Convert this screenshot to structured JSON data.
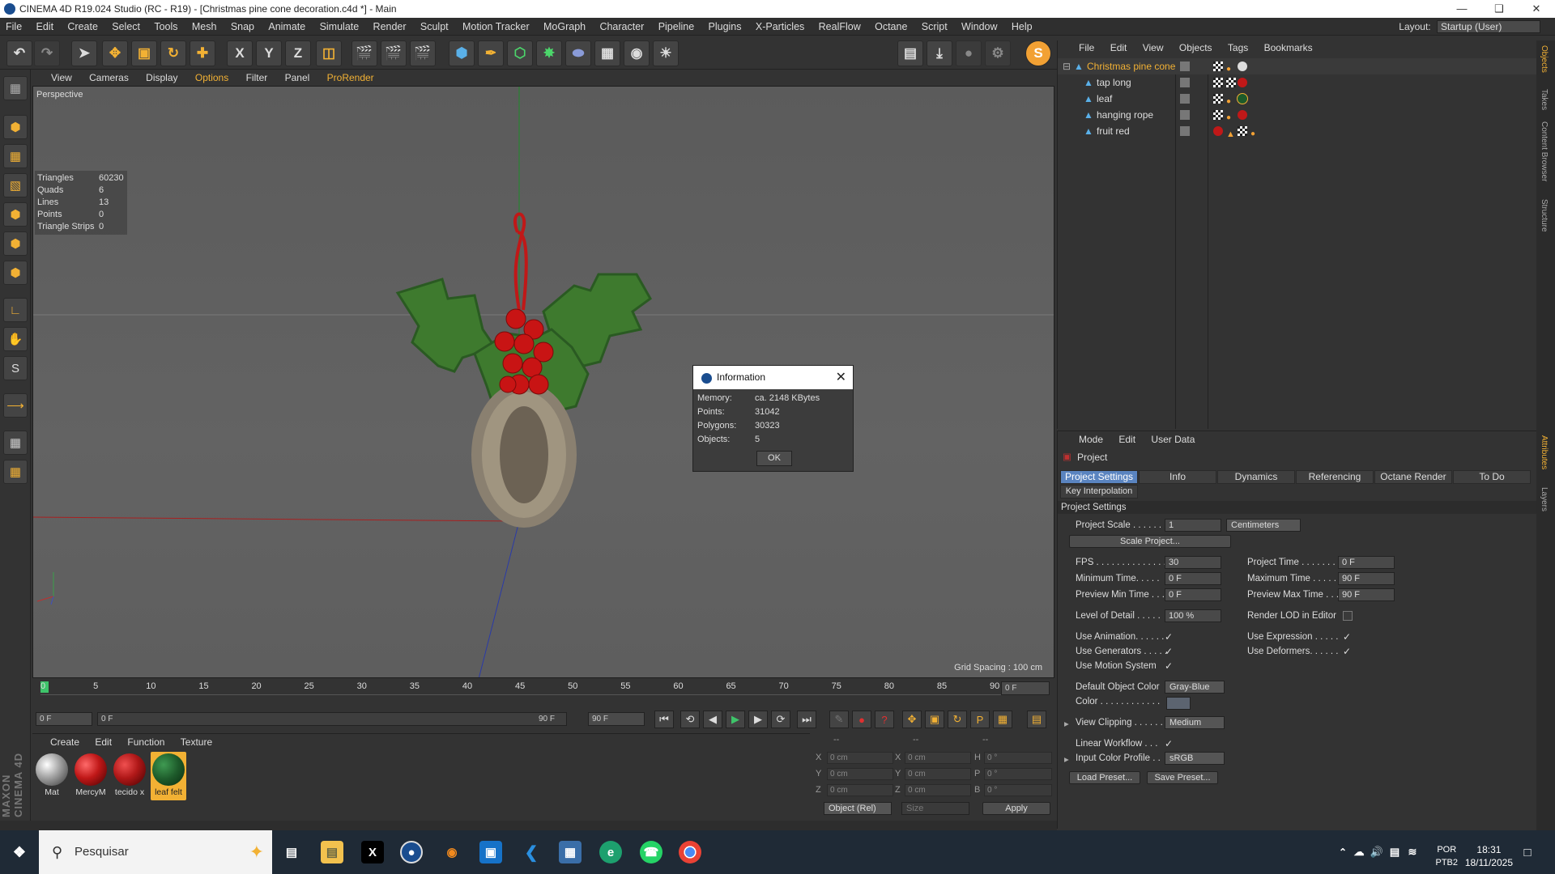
{
  "window": {
    "title": "CINEMA 4D R19.024 Studio (RC - R19) - [Christmas pine cone decoration.c4d *] - Main"
  },
  "menubar": {
    "items": [
      "File",
      "Edit",
      "Create",
      "Select",
      "Tools",
      "Mesh",
      "Snap",
      "Animate",
      "Simulate",
      "Render",
      "Sculpt",
      "Motion Tracker",
      "MoGraph",
      "Character",
      "Pipeline",
      "Plugins",
      "X-Particles",
      "RealFlow",
      "Octane",
      "Script",
      "Window",
      "Help"
    ],
    "layout_label": "Layout:",
    "layout_value": "Startup (User)"
  },
  "viewport": {
    "menu": [
      "View",
      "Cameras",
      "Display",
      "Options",
      "Filter",
      "Panel",
      "ProRender"
    ],
    "label": "Perspective",
    "stats": [
      {
        "k": "Triangles",
        "v": "60230"
      },
      {
        "k": "Quads",
        "v": "6"
      },
      {
        "k": "Lines",
        "v": "13"
      },
      {
        "k": "Points",
        "v": "0"
      },
      {
        "k": "Triangle Strips",
        "v": "0"
      }
    ],
    "grid_spacing": "Grid Spacing : 100 cm"
  },
  "dialog": {
    "title": "Information",
    "rows": [
      {
        "k": "Memory:",
        "v": "ca. 2148 KBytes"
      },
      {
        "k": "Points:",
        "v": "31042"
      },
      {
        "k": "Polygons:",
        "v": "30323"
      },
      {
        "k": "Objects:",
        "v": "5"
      }
    ],
    "ok": "OK"
  },
  "timeline": {
    "ticks": [
      "0",
      "5",
      "10",
      "15",
      "20",
      "25",
      "30",
      "35",
      "40",
      "45",
      "50",
      "55",
      "60",
      "65",
      "70",
      "75",
      "80",
      "85",
      "90"
    ],
    "current": "0 F",
    "start": "0 F",
    "range_start": "0 F",
    "range_end": "90 F",
    "end": "90 F"
  },
  "materials": {
    "menu": [
      "Create",
      "Edit",
      "Function",
      "Texture"
    ],
    "items": [
      {
        "label": "Mat",
        "color": "#d8d8d8"
      },
      {
        "label": "MercyM",
        "color": "#c01818"
      },
      {
        "label": "tecido x",
        "color": "#b01818"
      },
      {
        "label": "leaf felt",
        "color": "#1d5a2a"
      }
    ]
  },
  "coords": {
    "header": [
      "--",
      "--",
      "--"
    ],
    "rows": [
      {
        "a": "X",
        "av": "0 cm",
        "b": "X",
        "bv": "0 cm",
        "c": "H",
        "cv": "0 °"
      },
      {
        "a": "Y",
        "av": "0 cm",
        "b": "Y",
        "bv": "0 cm",
        "c": "P",
        "cv": "0 °"
      },
      {
        "a": "Z",
        "av": "0 cm",
        "b": "Z",
        "bv": "0 cm",
        "c": "B",
        "cv": "0 °"
      }
    ],
    "mode": "Object (Rel)",
    "size": "Size",
    "apply": "Apply"
  },
  "object_manager": {
    "menu": [
      "File",
      "Edit",
      "View",
      "Objects",
      "Tags",
      "Bookmarks"
    ],
    "objects": [
      {
        "name": "Christmas pine cone",
        "root": true
      },
      {
        "name": "tap long",
        "root": false
      },
      {
        "name": "leaf",
        "root": false
      },
      {
        "name": "hanging rope",
        "root": false
      },
      {
        "name": "fruit red",
        "root": false
      }
    ]
  },
  "attributes": {
    "menu": [
      "Mode",
      "Edit",
      "User Data"
    ],
    "title": "Project",
    "tabs": [
      "Project Settings",
      "Info",
      "Dynamics",
      "Referencing",
      "Octane Render",
      "To Do"
    ],
    "tab2": "Key Interpolation",
    "section": "Project Settings",
    "project_scale_label": "Project Scale . . . . . .",
    "project_scale": "1",
    "units": "Centimeters",
    "scale_project": "Scale Project...",
    "fps_label": "FPS . . . . . . . . . . . . . . .",
    "fps": "30",
    "project_time_label": "Project Time . . . . . . .",
    "project_time": "0 F",
    "min_time_label": "Minimum Time. . . . .",
    "min_time": "0 F",
    "max_time_label": "Maximum Time . . . . .",
    "max_time": "90 F",
    "prev_min_label": "Preview Min Time . . .",
    "prev_min": "0 F",
    "prev_max_label": "Preview Max Time . . .",
    "prev_max": "90 F",
    "lod_label": "Level of Detail . . . . .",
    "lod": "100 %",
    "render_lod_label": "Render LOD in Editor",
    "use_anim_label": "Use Animation. . . . . .",
    "use_expr_label": "Use Expression . . . . .",
    "use_gen_label": "Use Generators . . . . .",
    "use_def_label": "Use Deformers. . . . . .",
    "use_motion_label": "Use Motion System",
    "def_color_label": "Default Object Color",
    "def_color": "Gray-Blue",
    "color_label": "Color . . . . . . . . . . . .",
    "view_clip_label": "View Clipping . . . . . .",
    "view_clip": "Medium",
    "linear_label": "Linear Workflow . . .",
    "input_profile_label": "Input Color Profile . .",
    "input_profile": "sRGB",
    "load_preset": "Load Preset...",
    "save_preset": "Save Preset..."
  },
  "right_strip": [
    "Objects",
    "Takes",
    "Content Browser",
    "Structure",
    "Attributes",
    "Layers"
  ],
  "taskbar": {
    "search": "Pesquisar",
    "lang1": "POR",
    "lang2": "PTB2",
    "time": "18:31",
    "date": "18/11/2025"
  },
  "brand": "MAXON CINEMA 4D"
}
